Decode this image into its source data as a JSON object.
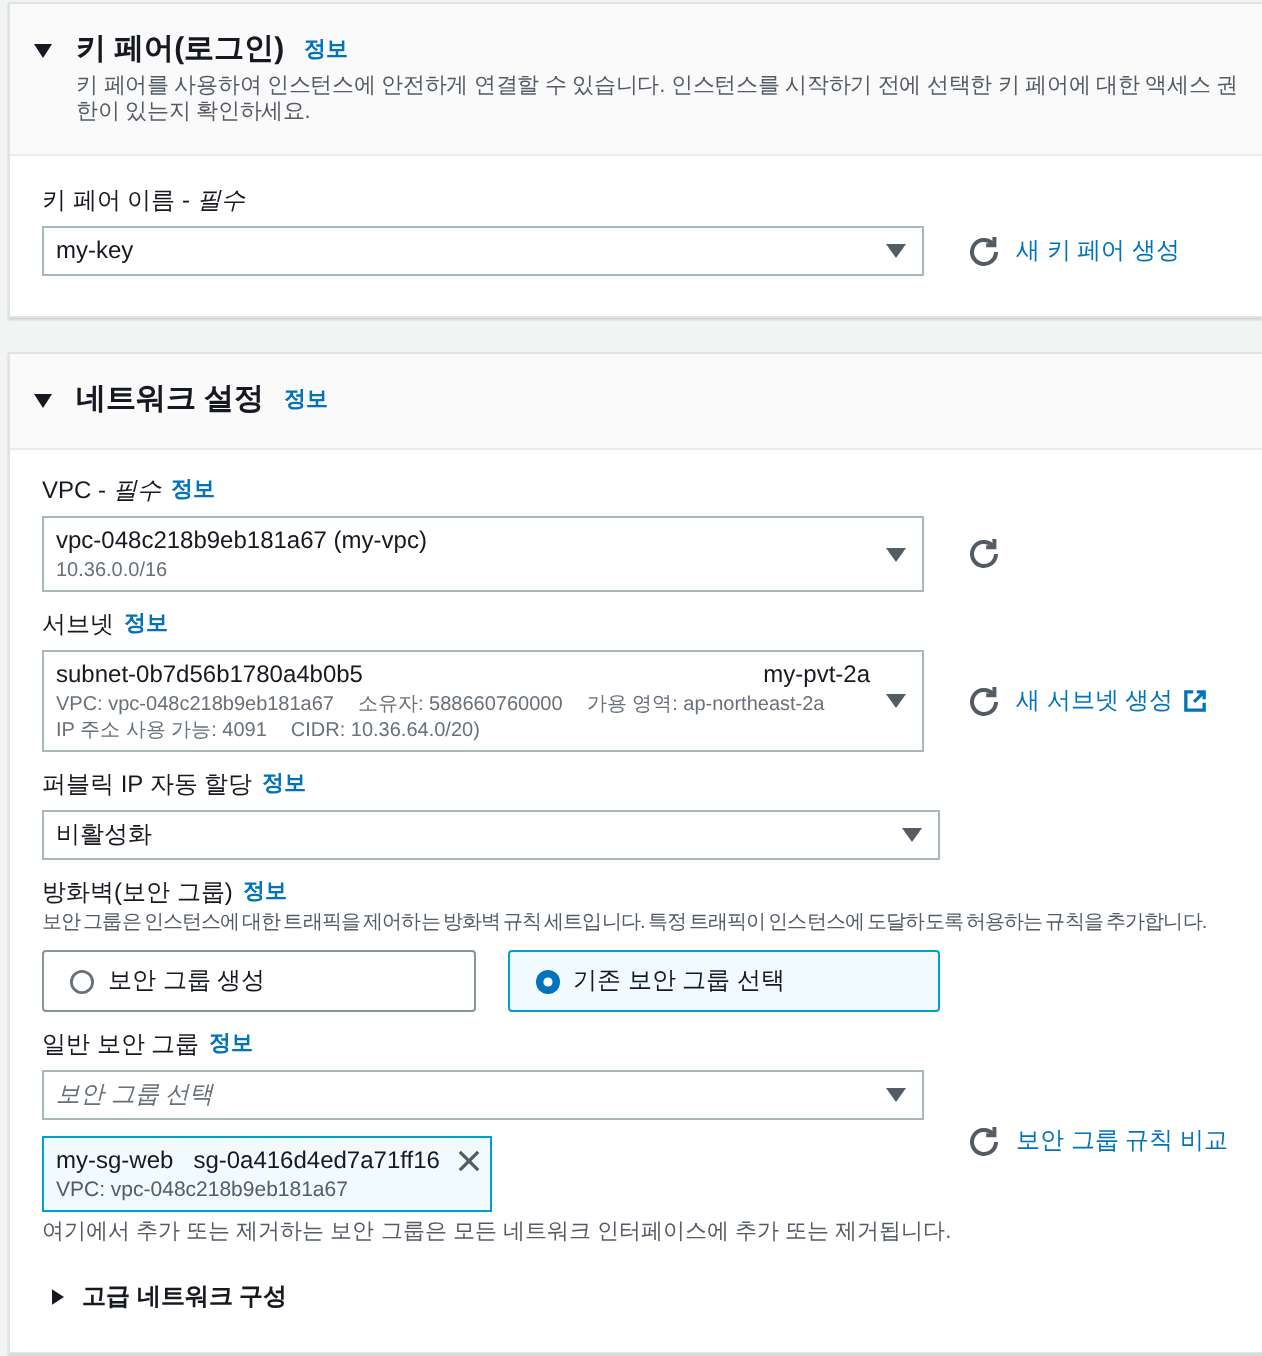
{
  "sections": [
    {
      "title": "키 페어(로그인)",
      "expanded": true,
      "info_link": "정보",
      "description": "키 페어를 사용하여 인스턴스에 안전하게 연결할 수 있습니다. 인스턴스를 시작하기 전에 선택한 키 페어에 대한 액세스 권한이 있는지 확인하세요.",
      "fields": [
        {
          "kind": "select",
          "label": "키 페어 이름 - *필수*",
          "value": "my-key",
          "refresh_button": true,
          "link": {
            "text": "새 키 페어 생성",
            "external": false
          }
        }
      ]
    },
    {
      "title": "네트워크 설정",
      "expanded": true,
      "info_link": "정보",
      "fields": [
        {
          "kind": "select",
          "label": "VPC - *필수*",
          "info_link": "정보",
          "value": "vpc-048c218b9eb181a67 (my-vpc)",
          "detail_lines": [
            [
              "10.36.0.0/16"
            ]
          ],
          "refresh_button": true
        },
        {
          "kind": "select",
          "label": "서브넷",
          "info_link": "정보",
          "value": "subnet-0b7d56b1780a4b0b5",
          "value_tag": "my-pvt-2a",
          "detail_lines": [
            [
              "VPC: vpc-048c218b9eb181a67",
              "소유자: 588660760000",
              "가용 영역: ap-northeast-2a"
            ],
            [
              "IP 주소 사용 가능: 4091",
              "CIDR: 10.36.64.0/20)"
            ]
          ],
          "refresh_button": true,
          "link": {
            "text": "새 서브넷 생성",
            "external": true
          }
        },
        {
          "kind": "select",
          "label": "퍼블릭 IP 자동 할당",
          "info_link": "정보",
          "value": "비활성화",
          "refresh_button": false
        },
        {
          "kind": "radio_tiles",
          "label": "방화벽(보안 그룹)",
          "info_link": "정보",
          "description": "보안 그룹은 인스턴스에 대한 트래픽을 제어하는 방화벽 규칙 세트입니다. 특정 트래픽이 인스턴스에 도달하도록 허용하는 규칙을 추가합니다.",
          "options": [
            {
              "label": "보안 그룹 생성",
              "selected": false
            },
            {
              "label": "기존 보안 그룹 선택",
              "selected": true
            }
          ]
        },
        {
          "kind": "multiselect",
          "label": "일반 보안 그룹",
          "info_link": "정보",
          "placeholder": "보안 그룹 선택",
          "tokens": [
            {
              "name": "my-sg-web",
              "id": "sg-0a416d4ed7a71ff16",
              "detail": "VPC: vpc-048c218b9eb181a67"
            }
          ],
          "hint": "여기에서 추가 또는 제거하는 보안 그룹은 모든 네트워크 인터페이스에 추가 또는 제거됩니다.",
          "refresh_button": true,
          "link": {
            "text": "보안 그룹 규칙 비교",
            "external": false
          }
        },
        {
          "kind": "expander",
          "label": "고급 네트워크 구성",
          "expanded": false
        }
      ]
    }
  ]
}
